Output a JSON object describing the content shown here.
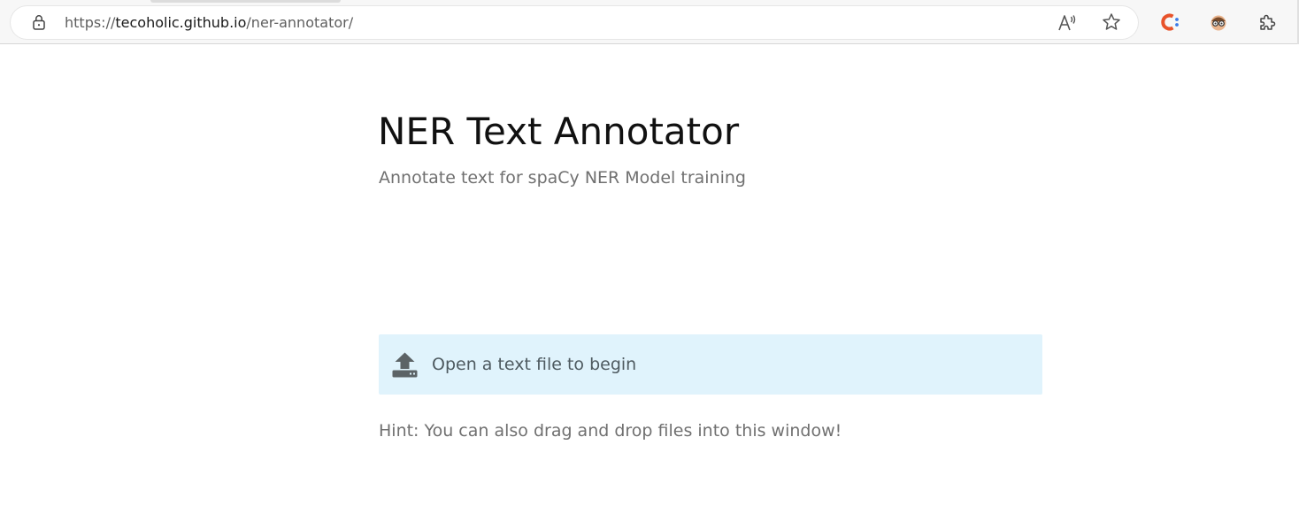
{
  "browser": {
    "url_scheme": "https://",
    "url_host": "tecoholic.github.io",
    "url_path": "/ner-annotator/",
    "icons": {
      "lock": "lock-icon",
      "read_aloud": "read-aloud-icon",
      "favorite": "star-icon",
      "extension_c": "extension-c-icon",
      "extension_face": "extension-face-icon",
      "extensions": "puzzle-icon"
    },
    "colors": {
      "extension_c": "#e8532b",
      "extension_c_dots": "#3b7be8"
    }
  },
  "main": {
    "title": "NER Text Annotator",
    "subtitle": "Annotate text for spaCy NER Model training",
    "open_file": {
      "label": "Open a text file to begin",
      "icon": "upload-icon",
      "background": "#e0f3fc"
    },
    "hint": "Hint: You can also drag and drop files into this window!"
  }
}
